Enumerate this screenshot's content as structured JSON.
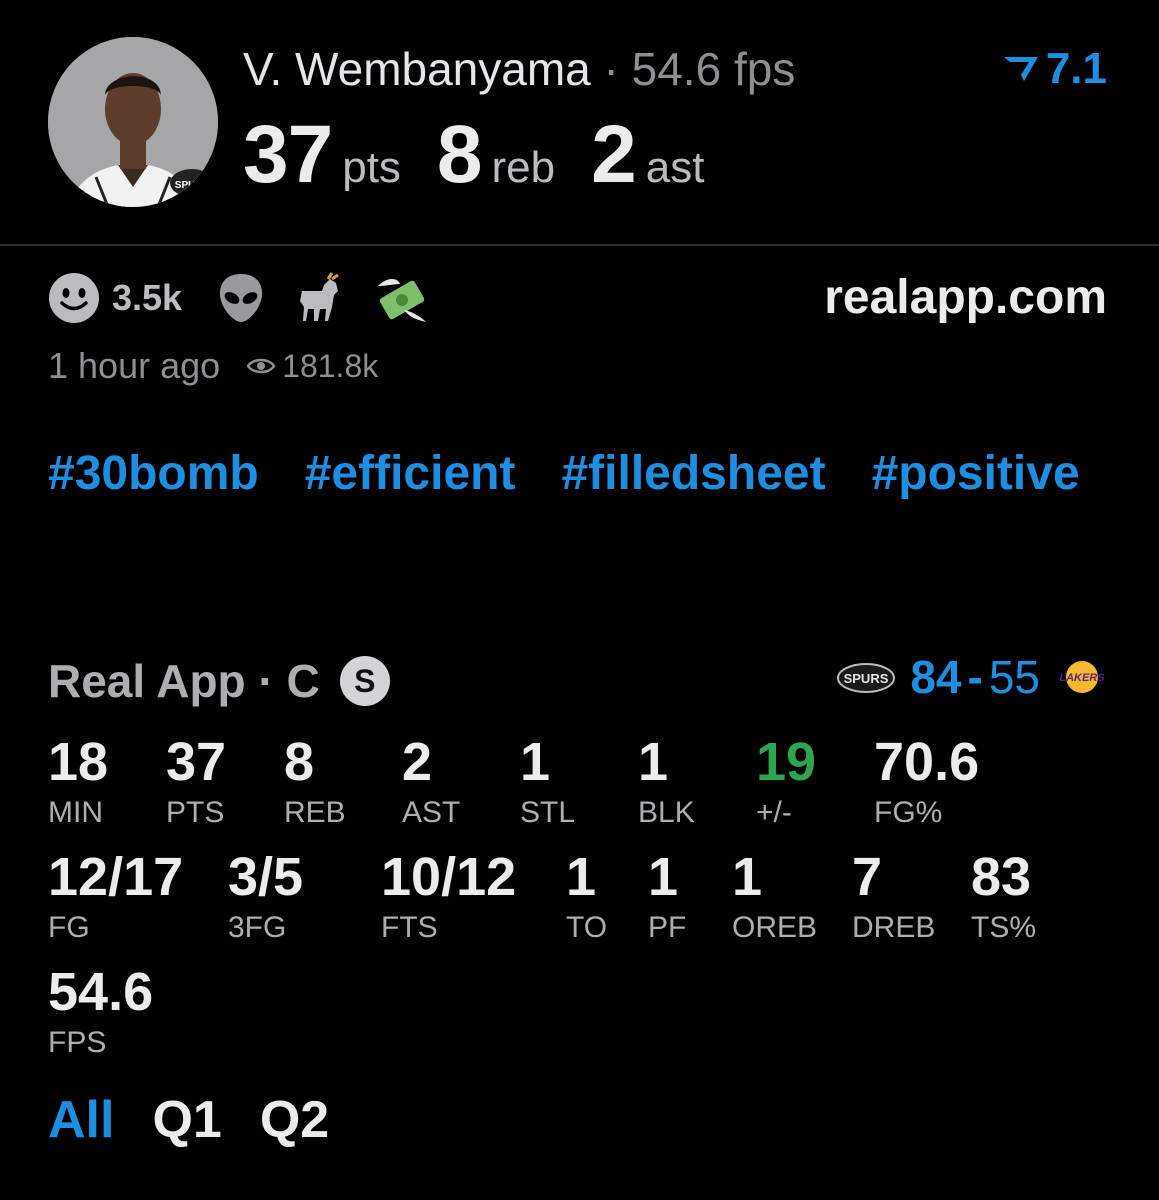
{
  "player": {
    "name": "V. Wembanyama",
    "separator": "·",
    "fps_text": "54.6 fps",
    "rating": "7.1",
    "headline": [
      {
        "value": "37",
        "unit": "pts"
      },
      {
        "value": "8",
        "unit": "reb"
      },
      {
        "value": "2",
        "unit": "ast"
      }
    ]
  },
  "reactions": {
    "smiley_count": "3.5k",
    "icons": [
      "smiley-icon",
      "alien-icon",
      "goat-icon",
      "money-wings-icon"
    ]
  },
  "site": "realapp.com",
  "meta": {
    "time_ago": "1 hour ago",
    "views": "181.8k"
  },
  "hashtags": [
    "#30bomb",
    "#efficient",
    "#filledsheet",
    "#positive"
  ],
  "game": {
    "label": "Real App · C",
    "badge": "S",
    "home_score": "84",
    "dash": "-",
    "away_score": "55"
  },
  "stats_row1": [
    {
      "value": "18",
      "label": "MIN"
    },
    {
      "value": "37",
      "label": "PTS"
    },
    {
      "value": "8",
      "label": "REB"
    },
    {
      "value": "2",
      "label": "AST"
    },
    {
      "value": "1",
      "label": "STL"
    },
    {
      "value": "1",
      "label": "BLK"
    },
    {
      "value": "19",
      "label": "+/-"
    },
    {
      "value": "70.6",
      "label": "FG%"
    }
  ],
  "stats_row2": [
    {
      "value": "12/17",
      "label": "FG"
    },
    {
      "value": "3/5",
      "label": "3FG"
    },
    {
      "value": "10/12",
      "label": "FTS"
    },
    {
      "value": "1",
      "label": "TO"
    },
    {
      "value": "1",
      "label": "PF"
    },
    {
      "value": "1",
      "label": "OREB"
    },
    {
      "value": "7",
      "label": "DREB"
    },
    {
      "value": "83",
      "label": "TS%"
    }
  ],
  "stats_row3": [
    {
      "value": "54.6",
      "label": "FPS"
    }
  ],
  "tabs": [
    "All",
    "Q1",
    "Q2"
  ],
  "colors": {
    "accent": "#1e8fe0",
    "positive": "#2ea44f",
    "background": "#000000"
  }
}
